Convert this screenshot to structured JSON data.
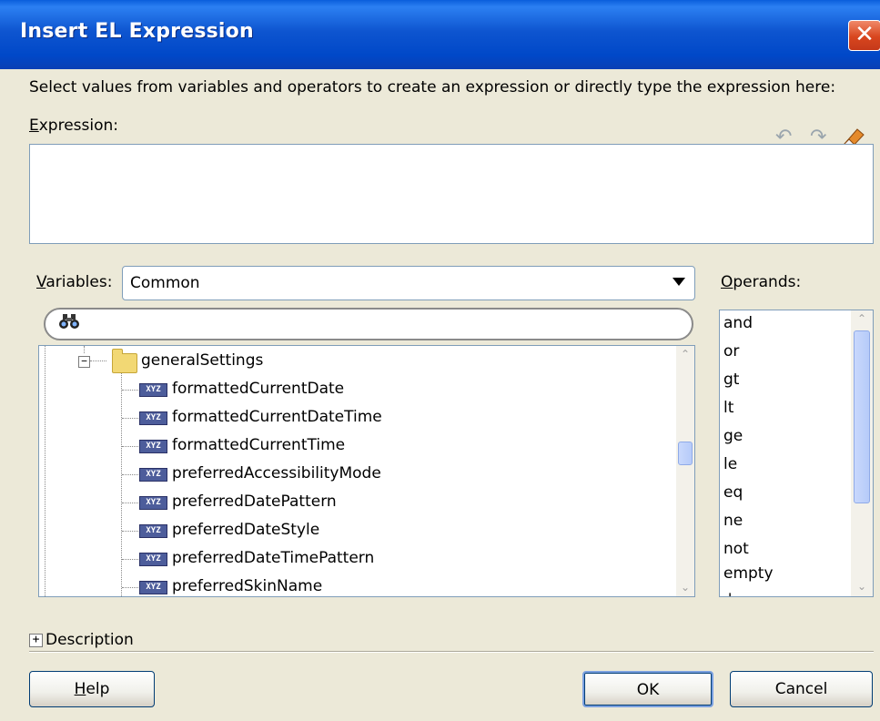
{
  "dialog": {
    "title": "Insert EL Expression",
    "close_icon": "close-icon"
  },
  "instruction": "Select values from variables and operators to create an expression or directly type the expression here:",
  "expression": {
    "label_mnemonic": "E",
    "label_rest": "xpression:",
    "value": ""
  },
  "toolbar": {
    "undo_icon": "undo-icon",
    "redo_icon": "redo-icon",
    "clear_icon": "eraser-icon"
  },
  "variables": {
    "label_mnemonic": "V",
    "label_rest": "ariables:",
    "selected": "Common",
    "search_icon": "binoculars-icon",
    "tree": {
      "folder": "generalSettings",
      "folder_expander": "−",
      "items": [
        "formattedCurrentDate",
        "formattedCurrentDateTime",
        "formattedCurrentTime",
        "preferredAccessibilityMode",
        "preferredDatePattern",
        "preferredDateStyle",
        "preferredDateTimePattern",
        "preferredSkinName"
      ],
      "item_badge": "XYZ"
    }
  },
  "operands": {
    "label_mnemonic": "O",
    "label_rest": "perands:",
    "items": [
      "and",
      "or",
      "gt",
      "lt",
      "ge",
      "le",
      "eq",
      "ne",
      "not",
      "empty",
      "+"
    ]
  },
  "description": {
    "expander": "+",
    "label": "Description"
  },
  "buttons": {
    "help_mnemonic": "H",
    "help_rest": "elp",
    "ok": "OK",
    "cancel": "Cancel"
  },
  "colors": {
    "title_bar": "#0A5EDC",
    "dialog_bg": "#ECE9D8",
    "field_border": "#7F9DB9",
    "scroll_thumb": "#C9D8FC"
  }
}
